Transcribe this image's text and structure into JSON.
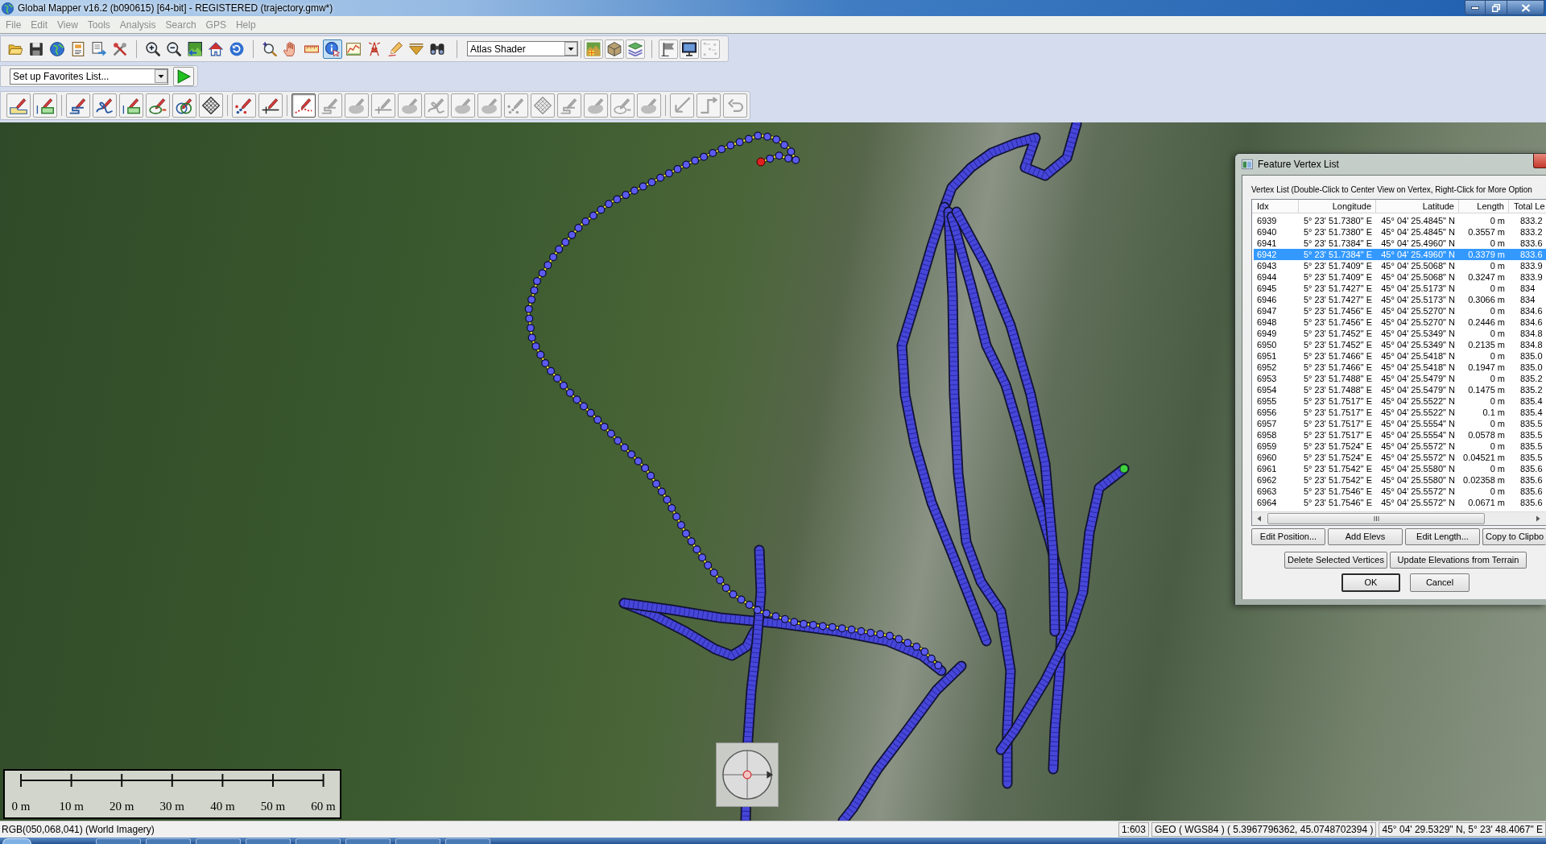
{
  "window": {
    "title": "Global Mapper v16.2 (b090615) [64-bit] - REGISTERED (trajectory.gmw*)"
  },
  "menu_bar": [
    {
      "label": "File",
      "disabled": true
    },
    {
      "label": "Edit",
      "disabled": true
    },
    {
      "label": "View",
      "disabled": true
    },
    {
      "label": "Tools",
      "disabled": true
    },
    {
      "label": "Analysis",
      "disabled": true
    },
    {
      "label": "Search",
      "disabled": true
    },
    {
      "label": "GPS",
      "disabled": true
    },
    {
      "label": "Help",
      "disabled": true
    }
  ],
  "main_toolbar": {
    "buttons": [
      {
        "selected": false
      },
      {
        "selected": false
      },
      {
        "selected": false
      },
      {
        "selected": false
      },
      {
        "selected": false
      },
      {
        "selected": false
      },
      {
        "selected": false
      },
      {
        "selected": false
      },
      {
        "selected": false
      },
      {
        "selected": false
      },
      {
        "selected": false
      },
      {
        "selected": false
      },
      {
        "selected": false
      },
      {
        "selected": false
      },
      {
        "selected": true
      },
      {
        "selected": false
      },
      {
        "selected": false
      },
      {
        "selected": false
      },
      {
        "selected": false
      },
      {
        "selected": false
      }
    ],
    "shader_dropdown": {
      "value": "Atlas Shader"
    },
    "view_buttons": [
      {
        "disabled": false
      },
      {
        "disabled": false
      },
      {
        "disabled": false
      },
      {
        "disabled": false
      },
      {
        "disabled": false
      },
      {
        "disabled": true
      }
    ]
  },
  "favorites_toolbar": {
    "dropdown": {
      "value": "Set up Favorites List..."
    }
  },
  "digitizer_toolbar": {
    "buttons": [
      {
        "selected": false,
        "disabled": false
      },
      {
        "selected": false,
        "disabled": false
      },
      {
        "selected": false,
        "disabled": false
      },
      {
        "selected": false,
        "disabled": false
      },
      {
        "selected": false,
        "disabled": false
      },
      {
        "selected": false,
        "disabled": false
      },
      {
        "selected": false,
        "disabled": false
      },
      {
        "selected": false,
        "disabled": false
      },
      {
        "selected": false,
        "disabled": false
      },
      {
        "selected": false,
        "disabled": false
      },
      {
        "selected": true,
        "disabled": false
      },
      {
        "selected": false,
        "disabled": true
      },
      {
        "selected": false,
        "disabled": true
      },
      {
        "selected": false,
        "disabled": true
      },
      {
        "selected": false,
        "disabled": true
      },
      {
        "selected": false,
        "disabled": true
      },
      {
        "selected": false,
        "disabled": true
      },
      {
        "selected": false,
        "disabled": true
      },
      {
        "selected": false,
        "disabled": true
      },
      {
        "selected": false,
        "disabled": true
      },
      {
        "selected": false,
        "disabled": true
      },
      {
        "selected": false,
        "disabled": true
      },
      {
        "selected": false,
        "disabled": true
      },
      {
        "selected": false,
        "disabled": true
      },
      {
        "selected": false,
        "disabled": true
      },
      {
        "selected": false,
        "disabled": true
      },
      {
        "selected": false,
        "disabled": true
      }
    ]
  },
  "map": {
    "scale_bar": {
      "labels": [
        "0 m",
        "10 m",
        "20 m",
        "30 m",
        "40 m",
        "50 m",
        "60 m"
      ]
    }
  },
  "vertex_dialog": {
    "title": "Feature Vertex List",
    "list_label": "Vertex List (Double-Click to Center View on Vertex, Right-Click for More Option",
    "columns": [
      "Idx",
      "Longitude",
      "Latitude",
      "Length",
      "Total Le"
    ],
    "rows": [
      {
        "cells": [
          "6939",
          "5° 23' 51.7380\" E",
          "45° 04' 25.4845\" N",
          "0 m",
          "833.2"
        ],
        "selected": false
      },
      {
        "cells": [
          "6940",
          "5° 23' 51.7380\" E",
          "45° 04' 25.4845\" N",
          "0.3557 m",
          "833.2"
        ],
        "selected": false
      },
      {
        "cells": [
          "6941",
          "5° 23' 51.7384\" E",
          "45° 04' 25.4960\" N",
          "0 m",
          "833.6"
        ],
        "selected": false
      },
      {
        "cells": [
          "6942",
          "5° 23' 51.7384\" E",
          "45° 04' 25.4960\" N",
          "0.3379 m",
          "833.6"
        ],
        "selected": true
      },
      {
        "cells": [
          "6943",
          "5° 23' 51.7409\" E",
          "45° 04' 25.5068\" N",
          "0 m",
          "833.9"
        ],
        "selected": false
      },
      {
        "cells": [
          "6944",
          "5° 23' 51.7409\" E",
          "45° 04' 25.5068\" N",
          "0.3247 m",
          "833.9"
        ],
        "selected": false
      },
      {
        "cells": [
          "6945",
          "5° 23' 51.7427\" E",
          "45° 04' 25.5173\" N",
          "0 m",
          "834"
        ],
        "selected": false
      },
      {
        "cells": [
          "6946",
          "5° 23' 51.7427\" E",
          "45° 04' 25.5173\" N",
          "0.3066 m",
          "834"
        ],
        "selected": false
      },
      {
        "cells": [
          "6947",
          "5° 23' 51.7456\" E",
          "45° 04' 25.5270\" N",
          "0 m",
          "834.6"
        ],
        "selected": false
      },
      {
        "cells": [
          "6948",
          "5° 23' 51.7456\" E",
          "45° 04' 25.5270\" N",
          "0.2446 m",
          "834.6"
        ],
        "selected": false
      },
      {
        "cells": [
          "6949",
          "5° 23' 51.7452\" E",
          "45° 04' 25.5349\" N",
          "0 m",
          "834.8"
        ],
        "selected": false
      },
      {
        "cells": [
          "6950",
          "5° 23' 51.7452\" E",
          "45° 04' 25.5349\" N",
          "0.2135 m",
          "834.8"
        ],
        "selected": false
      },
      {
        "cells": [
          "6951",
          "5° 23' 51.7466\" E",
          "45° 04' 25.5418\" N",
          "0 m",
          "835.0"
        ],
        "selected": false
      },
      {
        "cells": [
          "6952",
          "5° 23' 51.7466\" E",
          "45° 04' 25.5418\" N",
          "0.1947 m",
          "835.0"
        ],
        "selected": false
      },
      {
        "cells": [
          "6953",
          "5° 23' 51.7488\" E",
          "45° 04' 25.5479\" N",
          "0 m",
          "835.2"
        ],
        "selected": false
      },
      {
        "cells": [
          "6954",
          "5° 23' 51.7488\" E",
          "45° 04' 25.5479\" N",
          "0.1475 m",
          "835.2"
        ],
        "selected": false
      },
      {
        "cells": [
          "6955",
          "5° 23' 51.7517\" E",
          "45° 04' 25.5522\" N",
          "0 m",
          "835.4"
        ],
        "selected": false
      },
      {
        "cells": [
          "6956",
          "5° 23' 51.7517\" E",
          "45° 04' 25.5522\" N",
          "0.1 m",
          "835.4"
        ],
        "selected": false
      },
      {
        "cells": [
          "6957",
          "5° 23' 51.7517\" E",
          "45° 04' 25.5554\" N",
          "0 m",
          "835.5"
        ],
        "selected": false
      },
      {
        "cells": [
          "6958",
          "5° 23' 51.7517\" E",
          "45° 04' 25.5554\" N",
          "0.0578 m",
          "835.5"
        ],
        "selected": false
      },
      {
        "cells": [
          "6959",
          "5° 23' 51.7524\" E",
          "45° 04' 25.5572\" N",
          "0 m",
          "835.5"
        ],
        "selected": false
      },
      {
        "cells": [
          "6960",
          "5° 23' 51.7524\" E",
          "45° 04' 25.5572\" N",
          "0.04521 m",
          "835.5"
        ],
        "selected": false
      },
      {
        "cells": [
          "6961",
          "5° 23' 51.7542\" E",
          "45° 04' 25.5580\" N",
          "0 m",
          "835.6"
        ],
        "selected": false
      },
      {
        "cells": [
          "6962",
          "5° 23' 51.7542\" E",
          "45° 04' 25.5580\" N",
          "0.02358 m",
          "835.6"
        ],
        "selected": false
      },
      {
        "cells": [
          "6963",
          "5° 23' 51.7546\" E",
          "45° 04' 25.5572\" N",
          "0 m",
          "835.6"
        ],
        "selected": false
      },
      {
        "cells": [
          "6964",
          "5° 23' 51.7546\" E",
          "45° 04' 25.5572\" N",
          "0.0671 m",
          "835.6"
        ],
        "selected": false
      }
    ],
    "buttons": [
      {
        "label": "Edit Position...",
        "default": false
      },
      {
        "label": "Add Elevs",
        "default": false
      },
      {
        "label": "Edit Length...",
        "default": false
      },
      {
        "label": "Copy to Clipbo",
        "default": false
      },
      {
        "label": "Delete Selected Vertices",
        "default": false
      },
      {
        "label": "Update Elevations from Terrain",
        "default": false
      },
      {
        "label": "OK",
        "default": true
      },
      {
        "label": "Cancel",
        "default": false
      }
    ]
  },
  "status_bar": {
    "info": "RGB(050,068,041) (World Imagery)",
    "scale": "1:603",
    "projection": "GEO ( WGS84 ) ( 5.3967796362, 45.0748702394 )",
    "position": "45° 04' 29.5329\" N, 5° 23' 48.4067\" E"
  }
}
